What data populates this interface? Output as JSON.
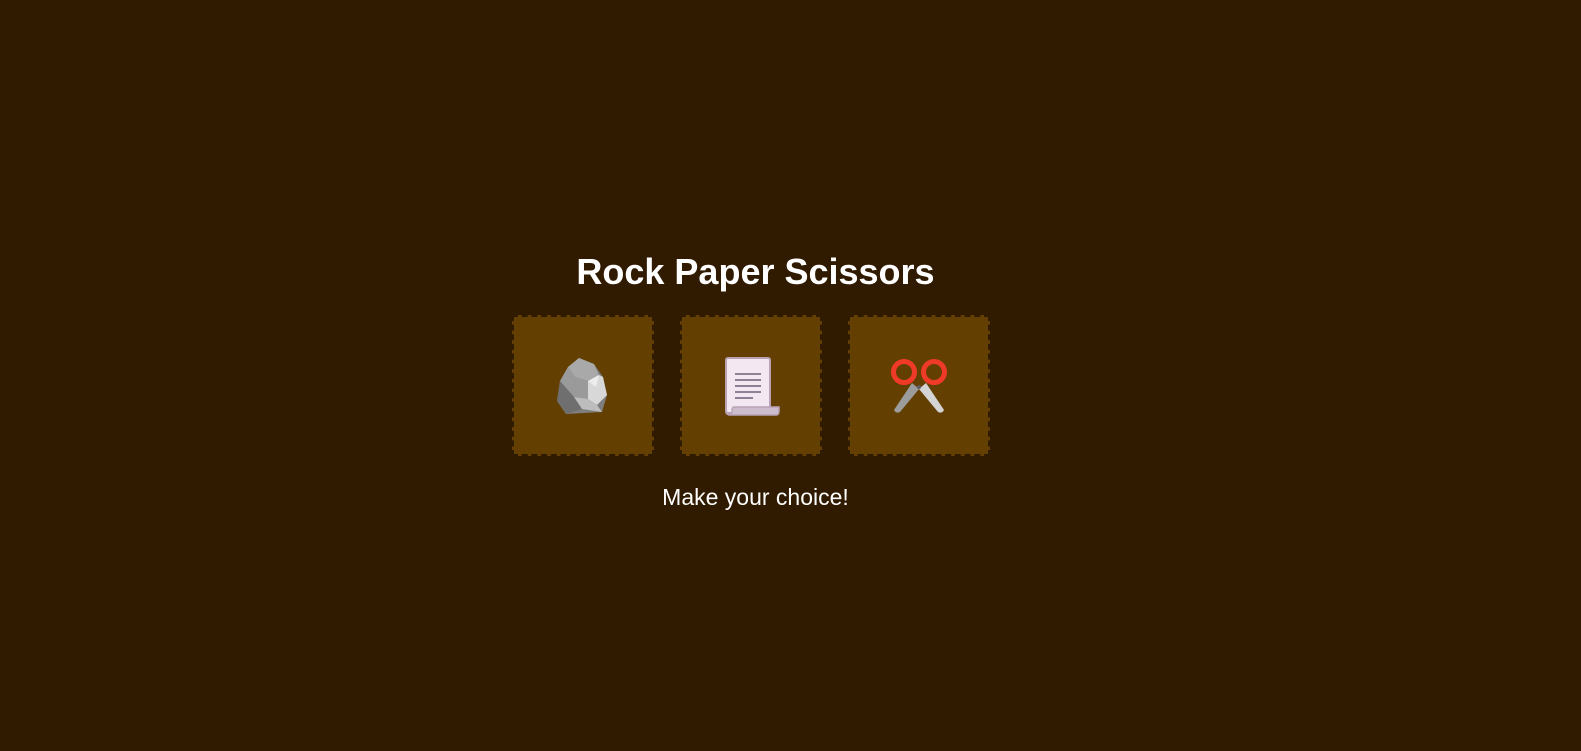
{
  "game": {
    "title": "Rock Paper Scissors",
    "message": "Make your choice!",
    "choices": [
      {
        "id": "rock",
        "icon": "rock-icon"
      },
      {
        "id": "paper",
        "icon": "scroll-icon"
      },
      {
        "id": "scissors",
        "icon": "scissors-icon"
      }
    ]
  },
  "colors": {
    "background": "#301a00",
    "choice_tile": "#643f02",
    "choice_border": "#2f1a02",
    "text": "#ffffff",
    "scissors_handle": "#f03a28"
  }
}
